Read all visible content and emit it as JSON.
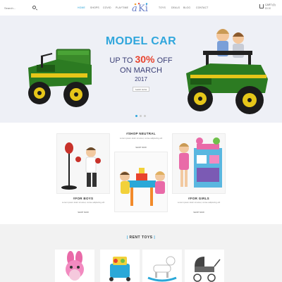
{
  "header": {
    "search_placeholder": "Search...",
    "nav": [
      "HOME",
      "SHOPS",
      "COVID",
      "PLAYTIME",
      "TOYS",
      "DEALS",
      "BLOG",
      "CONTACT"
    ],
    "active_index": 0,
    "logo_a": "a",
    "logo_ki": "Ki",
    "cart_label": "CART (0)",
    "cart_total": "$0.00"
  },
  "hero": {
    "title": "MODEL CAR",
    "line1_prefix": "UP TO ",
    "line1_pct": "30%",
    "line1_suffix": " OFF",
    "line2": "ON MARCH",
    "line3": "2017",
    "button": "SHOP NOW",
    "slides": 3,
    "active_slide": 0
  },
  "categories": {
    "neutral": {
      "heading": "#SHOP NEUTRAL",
      "desc": "Lorem ipsum dolor sit amet, conse adipiscing elit",
      "button": "SHOP NOW"
    },
    "boys": {
      "heading": "#FOR BOYS",
      "desc": "Lorem ipsum dolor sit amet, conse adipiscing elit",
      "button": "SHOP NOW"
    },
    "girls": {
      "heading": "#FOR GIRLS",
      "desc": "Lorem ipsum dolor sit amet, conse adipiscing elit",
      "button": "SHOP NOW"
    }
  },
  "rent": {
    "bar_left": "|",
    "title": "RENT TOYS",
    "bar_right": "|"
  },
  "colors": {
    "accent": "#2fa6dc",
    "sale": "#e8432e",
    "navy": "#3b3f76",
    "hero_bg": "#eef0f6",
    "tractor_green": "#2c7b22",
    "tractor_yellow": "#e6c619"
  }
}
